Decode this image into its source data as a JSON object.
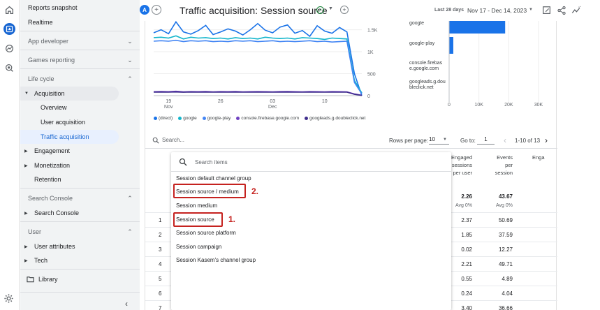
{
  "rail": {
    "icons": [
      "home-icon",
      "reports-icon",
      "explore-icon",
      "advertising-icon"
    ],
    "settings_icon": "gear-icon"
  },
  "sidebar": {
    "reports_snapshot": "Reports snapshot",
    "realtime": "Realtime",
    "app_developer": "App developer",
    "games_reporting": "Games reporting",
    "life_cycle": "Life cycle",
    "acquisition": "Acquisition",
    "overview": "Overview",
    "user_acquisition": "User acquisition",
    "traffic_acquisition": "Traffic acquisition",
    "engagement": "Engagement",
    "monetization": "Monetization",
    "retention": "Retention",
    "search_console_section": "Search Console",
    "search_console_item": "Search Console",
    "user_section": "User",
    "user_attributes": "User attributes",
    "tech": "Tech",
    "library": "Library"
  },
  "header": {
    "avatar_letter": "A",
    "title": "Traffic acquisition: Session source",
    "date_label": "Last 28 days",
    "date_range": "Nov 17 - Dec 14, 2023"
  },
  "chart_data": [
    {
      "type": "line",
      "x_ticks": [
        {
          "day": "19",
          "month": "Nov"
        },
        {
          "day": "26",
          "month": ""
        },
        {
          "day": "03",
          "month": "Dec"
        },
        {
          "day": "10",
          "month": ""
        }
      ],
      "y_ticks": [
        "1.5K",
        "1K",
        "500",
        "0"
      ],
      "ylim": [
        0,
        1700
      ],
      "series": [
        {
          "name": "(direct)",
          "color": "#1a73e8",
          "values": [
            1430,
            1500,
            1410,
            1680,
            1450,
            1400,
            1480,
            1600,
            1390,
            1450,
            1520,
            1470,
            1380,
            1500,
            1640,
            1490,
            1430,
            1560,
            1610,
            1420,
            1480,
            1350,
            1590,
            1470,
            1420,
            1550,
            1450,
            500,
            0
          ]
        },
        {
          "name": "google",
          "color": "#12b5cb",
          "values": [
            1320,
            1330,
            1310,
            1360,
            1290,
            1330,
            1310,
            1320,
            1300,
            1310,
            1290,
            1320,
            1300,
            1310,
            1290,
            1330,
            1310,
            1300,
            1310,
            1290,
            1320,
            1310,
            1300,
            1280,
            1310,
            1300,
            1290,
            350,
            60
          ]
        },
        {
          "name": "google-play",
          "color": "#4285f4",
          "values": [
            1240,
            1250,
            1240,
            1260,
            1230,
            1250,
            1240,
            1250,
            1230,
            1240,
            1230,
            1250,
            1240,
            1250,
            1230,
            1240,
            1250,
            1230,
            1240,
            1230,
            1240,
            1250,
            1230,
            1240,
            1220,
            1230,
            1240,
            300,
            40
          ]
        },
        {
          "name": "console.firebase.google.com",
          "color": "#6f42c1",
          "values": [
            90,
            95,
            90,
            100,
            88,
            92,
            90,
            95,
            88,
            92,
            90,
            95,
            88,
            90,
            92,
            90,
            88,
            92,
            95,
            90,
            88,
            92,
            90,
            88,
            92,
            90,
            88,
            40,
            10
          ]
        },
        {
          "name": "googleads.g.doubleclick.net",
          "color": "#3f2d8c",
          "values": [
            80,
            82,
            80,
            84,
            78,
            82,
            80,
            82,
            79,
            81,
            80,
            82,
            79,
            80,
            81,
            80,
            79,
            81,
            82,
            80,
            79,
            81,
            80,
            79,
            81,
            80,
            79,
            30,
            5
          ]
        }
      ]
    },
    {
      "type": "bar",
      "categories": [
        "google",
        "google-play",
        "console.firebase.google.com",
        "googleads.g.doubleclick.net"
      ],
      "category_lines": [
        [
          "google"
        ],
        [
          "google-play"
        ],
        [
          "console.firebas",
          "e.google.com"
        ],
        [
          "googleads.g.dou",
          "bleclick.net"
        ]
      ],
      "values": [
        18800,
        1400,
        0,
        0
      ],
      "x_ticks": [
        "0",
        "10K",
        "20K",
        "30K"
      ],
      "xlim": [
        0,
        30000
      ]
    }
  ],
  "table": {
    "search_placeholder": "Search...",
    "rows_per_page_label": "Rows per page:",
    "rows_per_page_value": "10",
    "goto_label": "Go to:",
    "goto_value": "1",
    "page_info": "1-10 of 13",
    "headers": {
      "engaged": [
        "Engaged",
        "sessions",
        "per user"
      ],
      "events": [
        "Events",
        "per",
        "session"
      ],
      "third": "Enga"
    },
    "totals": {
      "engaged": "2.26",
      "engaged_sub": "Avg 0%",
      "events": "43.67",
      "events_sub": "Avg 0%"
    },
    "rows": [
      {
        "n": "1",
        "engaged": "2.37",
        "events": "50.69"
      },
      {
        "n": "2",
        "engaged": "1.85",
        "events": "37.59"
      },
      {
        "n": "3",
        "engaged": "0.02",
        "events": "12.27"
      },
      {
        "n": "4",
        "engaged": "2.21",
        "events": "49.71"
      },
      {
        "n": "5",
        "engaged": "0.55",
        "events": "4.89"
      },
      {
        "n": "6",
        "engaged": "0.24",
        "events": "4.04"
      },
      {
        "n": "7",
        "engaged": "3.40",
        "events": "36.66"
      }
    ]
  },
  "dropdown": {
    "search_placeholder": "Search items",
    "items": [
      "Session default channel group",
      "Session source / medium",
      "Session medium",
      "Session source",
      "Session source platform",
      "Session campaign",
      "Session Kasem's channel group"
    ],
    "annotation_1": "1.",
    "annotation_2": "2."
  }
}
